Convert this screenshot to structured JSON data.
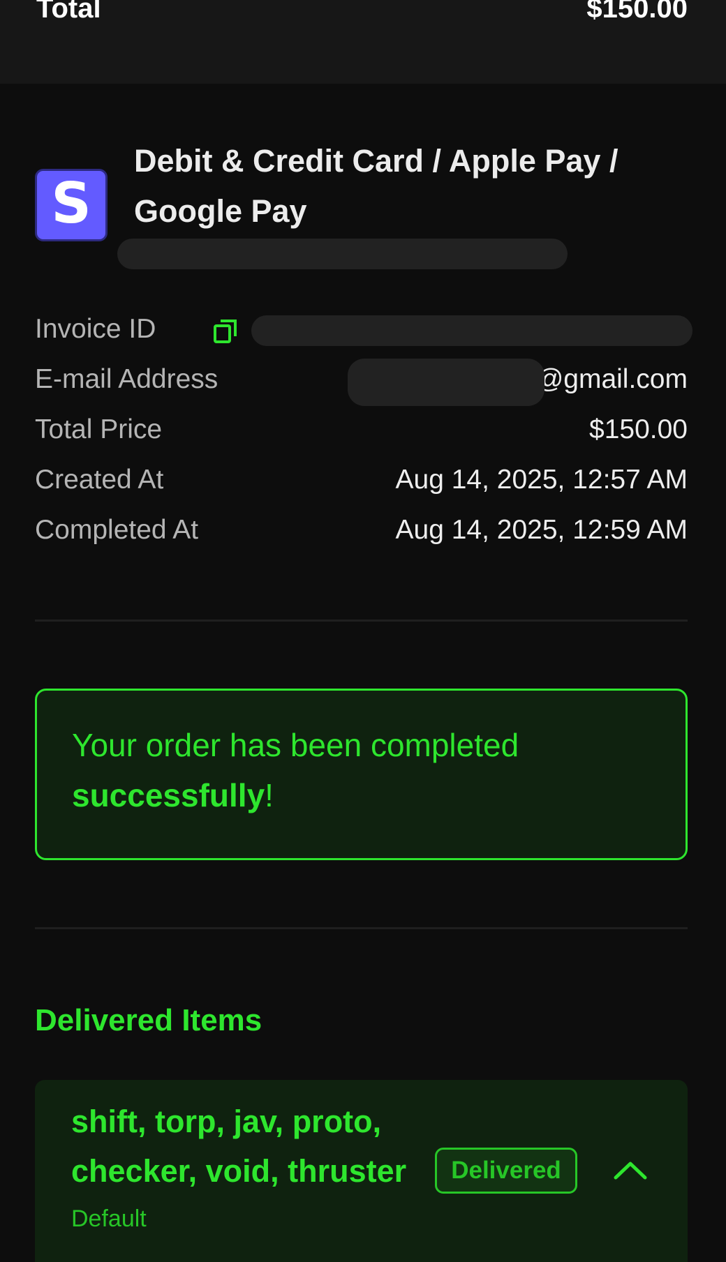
{
  "header": {
    "total_label": "Total",
    "total_value": "$150.00"
  },
  "payment": {
    "logo_letter": "S",
    "logo_color": "#635bff",
    "method_label": "Debit & Credit Card / Apple Pay / Google Pay",
    "transaction_id": "redacted"
  },
  "details": {
    "invoice_label": "Invoice ID",
    "invoice_value": "redacted",
    "email_label": "E-mail Address",
    "email_value": "@gmail.com",
    "total_price_label": "Total Price",
    "total_price_value": "$150.00",
    "created_label": "Created At",
    "created_value": "Aug 14, 2025, 12:57 AM",
    "completed_label": "Completed At",
    "completed_value": "Aug 14, 2025, 12:59 AM"
  },
  "success": {
    "message_prefix": "Your order has been completed ",
    "message_bold": "successfully",
    "message_suffix": "!"
  },
  "delivered": {
    "title": "Delivered Items",
    "items": [
      {
        "name": "shift, torp, jav, proto, checker, void, thruster",
        "variant": "Default",
        "status": "Delivered"
      }
    ]
  },
  "colors": {
    "accent_green": "#2ee62e",
    "background": "#0d0d0d"
  }
}
